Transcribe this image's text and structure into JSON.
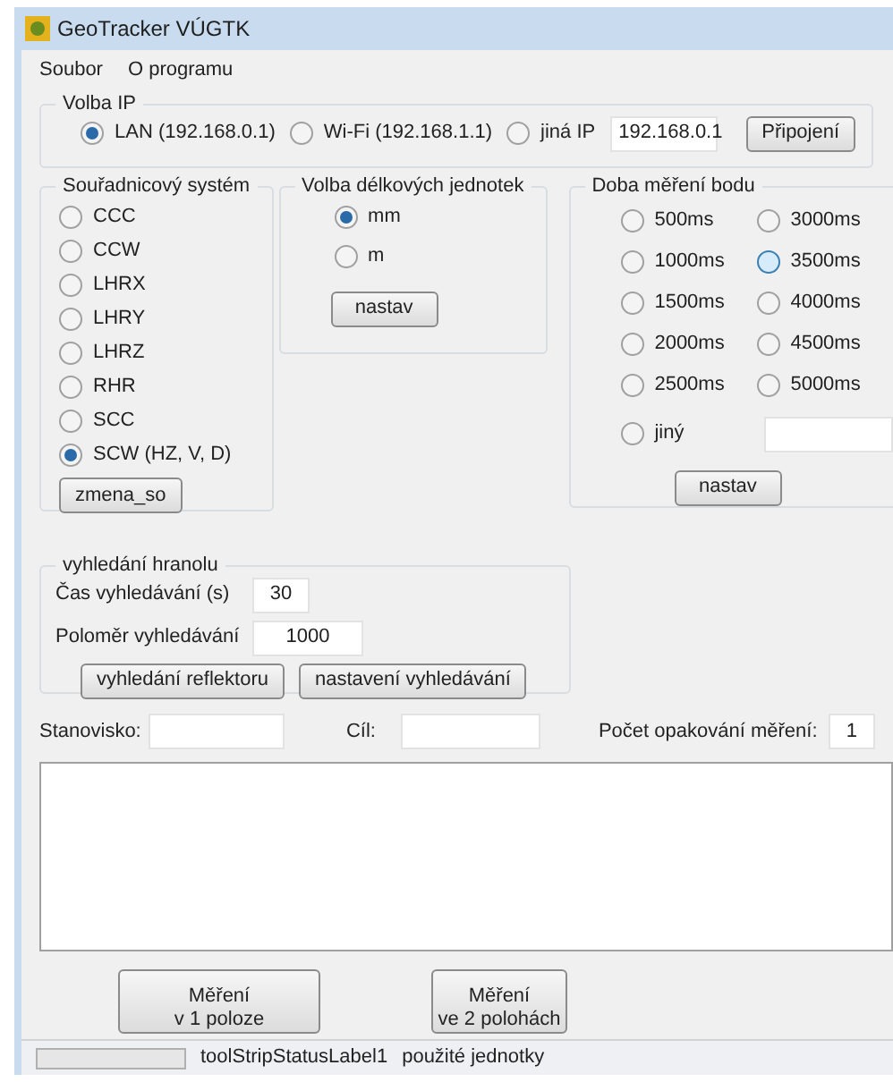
{
  "window": {
    "title": "GeoTracker VÚGTK"
  },
  "menu": [
    "Soubor",
    "O programu"
  ],
  "ip_group": {
    "title": "Volba IP",
    "options": [
      {
        "label": "LAN (192.168.0.1)",
        "selected": true
      },
      {
        "label": "Wi-Fi (192.168.1.1)",
        "selected": false
      },
      {
        "label": "jiná IP",
        "selected": false
      }
    ],
    "ip_value": "192.168.0.1",
    "connect_button": "Připojení"
  },
  "coord_group": {
    "title": "Souřadnicový systém",
    "options": [
      {
        "label": "CCC",
        "selected": false
      },
      {
        "label": "CCW",
        "selected": false
      },
      {
        "label": "LHRX",
        "selected": false
      },
      {
        "label": "LHRY",
        "selected": false
      },
      {
        "label": "LHRZ",
        "selected": false
      },
      {
        "label": "RHR",
        "selected": false
      },
      {
        "label": "SCC",
        "selected": false
      },
      {
        "label": "SCW (HZ, V, D)",
        "selected": true
      }
    ],
    "button": "zmena_so"
  },
  "units_group": {
    "title": "Volba délkových jednotek",
    "options": [
      {
        "label": "mm",
        "selected": true
      },
      {
        "label": "m",
        "selected": false
      }
    ],
    "button": "nastav"
  },
  "time_group": {
    "title": "Doba měření bodu",
    "options": [
      {
        "label": "500ms",
        "selected": false,
        "hovered": false
      },
      {
        "label": "3000ms",
        "selected": false,
        "hovered": false
      },
      {
        "label": "1000ms",
        "selected": false,
        "hovered": false
      },
      {
        "label": "3500ms",
        "selected": false,
        "hovered": true
      },
      {
        "label": "1500ms",
        "selected": false,
        "hovered": false
      },
      {
        "label": "4000ms",
        "selected": false,
        "hovered": false
      },
      {
        "label": "2000ms",
        "selected": false,
        "hovered": false
      },
      {
        "label": "4500ms",
        "selected": false,
        "hovered": false
      },
      {
        "label": "2500ms",
        "selected": false,
        "hovered": false
      },
      {
        "label": "5000ms",
        "selected": false,
        "hovered": false
      }
    ],
    "other": {
      "label": "jiný",
      "selected": false
    },
    "button": "nastav"
  },
  "search_group": {
    "title": "vyhledání hranolu",
    "fields": [
      {
        "label": "Čas vyhledávání (s)",
        "value": "30"
      },
      {
        "label": "Poloměr vyhledávání",
        "value": "1000"
      }
    ],
    "buttons": [
      "vyhledání reflektoru",
      "nastavení vyhledávání"
    ]
  },
  "station_row": {
    "station_label": "Stanovisko:",
    "target_label": "Cíl:",
    "repeat_label": "Počet opakování měření:",
    "repeat_value": "1"
  },
  "measure_buttons": [
    {
      "lines": [
        "Měření",
        "v 1 poloze"
      ]
    },
    {
      "lines": [
        "Měření",
        "ve 2 polohách"
      ]
    }
  ],
  "status_bar": {
    "progress": {
      "level": 0
    },
    "labels": [
      "toolStripStatusLabel1",
      "použité jednotky"
    ]
  }
}
